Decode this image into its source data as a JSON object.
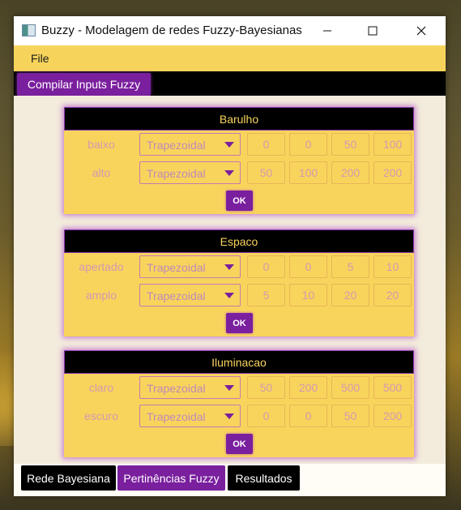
{
  "window": {
    "title": "Buzzy - Modelagem de redes Fuzzy-Bayesianas",
    "menu": [
      "File"
    ]
  },
  "toolbar": {
    "compile_label": "Compilar Inputs Fuzzy"
  },
  "panels": [
    {
      "title": "Barulho",
      "rows": [
        {
          "label": "baixo",
          "type": "Trapezoidal",
          "values": [
            "0",
            "0",
            "50",
            "100"
          ]
        },
        {
          "label": "alto",
          "type": "Trapezoidal",
          "values": [
            "50",
            "100",
            "200",
            "200"
          ]
        }
      ],
      "ok_label": "OK"
    },
    {
      "title": "Espaco",
      "rows": [
        {
          "label": "apertado",
          "type": "Trapezoidal",
          "values": [
            "0",
            "0",
            "5",
            "10"
          ]
        },
        {
          "label": "amplo",
          "type": "Trapezoidal",
          "values": [
            "5",
            "10",
            "20",
            "20"
          ]
        }
      ],
      "ok_label": "OK"
    },
    {
      "title": "Iluminacao",
      "rows": [
        {
          "label": "claro",
          "type": "Trapezoidal",
          "values": [
            "50",
            "200",
            "500",
            "500"
          ]
        },
        {
          "label": "escuro",
          "type": "Trapezoidal",
          "values": [
            "0",
            "0",
            "50",
            "200"
          ]
        }
      ],
      "ok_label": "OK"
    }
  ],
  "tabs": [
    {
      "label": "Rede Bayesiana",
      "active": false
    },
    {
      "label": "Pertinências Fuzzy",
      "active": true
    },
    {
      "label": "Resultados",
      "active": false
    }
  ],
  "colors": {
    "accent": "#7a1f9e",
    "panel": "#f8d45c",
    "menubar": "#f6d45c",
    "toolbar": "#000000"
  }
}
